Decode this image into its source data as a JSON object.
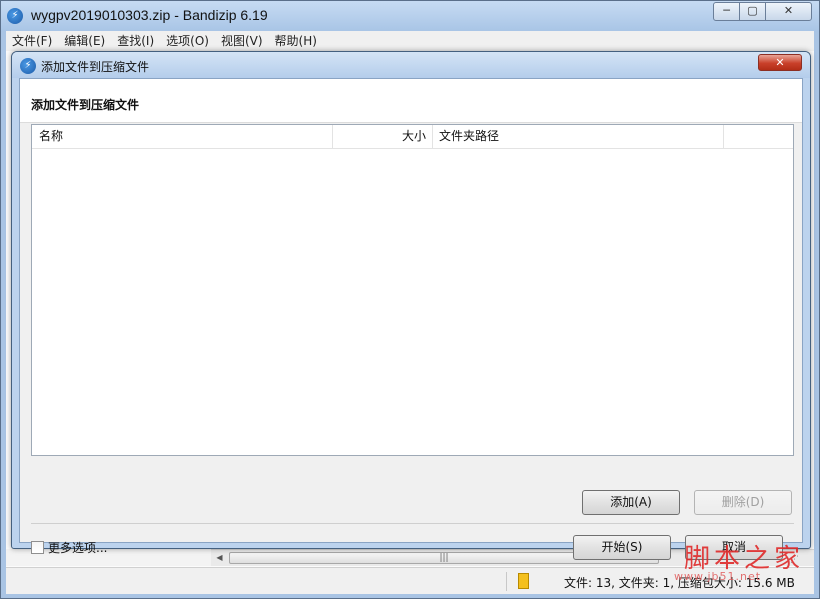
{
  "main_window": {
    "title": "wygpv2019010303.zip - Bandizip 6.19",
    "app_icon": "bandizip-icon",
    "controls": {
      "minimize": "─",
      "maximize": "▢",
      "close": "✕"
    }
  },
  "menu": {
    "items": [
      {
        "label": "文件(F)"
      },
      {
        "label": "编辑(E)"
      },
      {
        "label": "查找(I)"
      },
      {
        "label": "选项(O)"
      },
      {
        "label": "视图(V)"
      },
      {
        "label": "帮助(H)"
      }
    ]
  },
  "dialog": {
    "title": "添加文件到压缩文件",
    "heading": "添加文件到压缩文件",
    "close_label": "✕",
    "columns": [
      {
        "label": "名称"
      },
      {
        "label": "大小"
      },
      {
        "label": "文件夹路径"
      },
      {
        "label": ""
      }
    ],
    "add_button": "添加(A)",
    "delete_button": "删除(D)",
    "more_options_label": "更多选项...",
    "more_options_checked": false,
    "start_button": "开始(S)",
    "cancel_button": "取消"
  },
  "status_bar": {
    "text": "文件: 13, 文件夹: 1, 压缩包大小: 15.6 MB"
  },
  "watermark": {
    "text_cn": "脚本之家",
    "text_url": "www.jb51.net"
  },
  "colors": {
    "titlebar": "#b4cdeb",
    "close_button": "#c9402a",
    "dialog_body": "#f0f0f0"
  }
}
